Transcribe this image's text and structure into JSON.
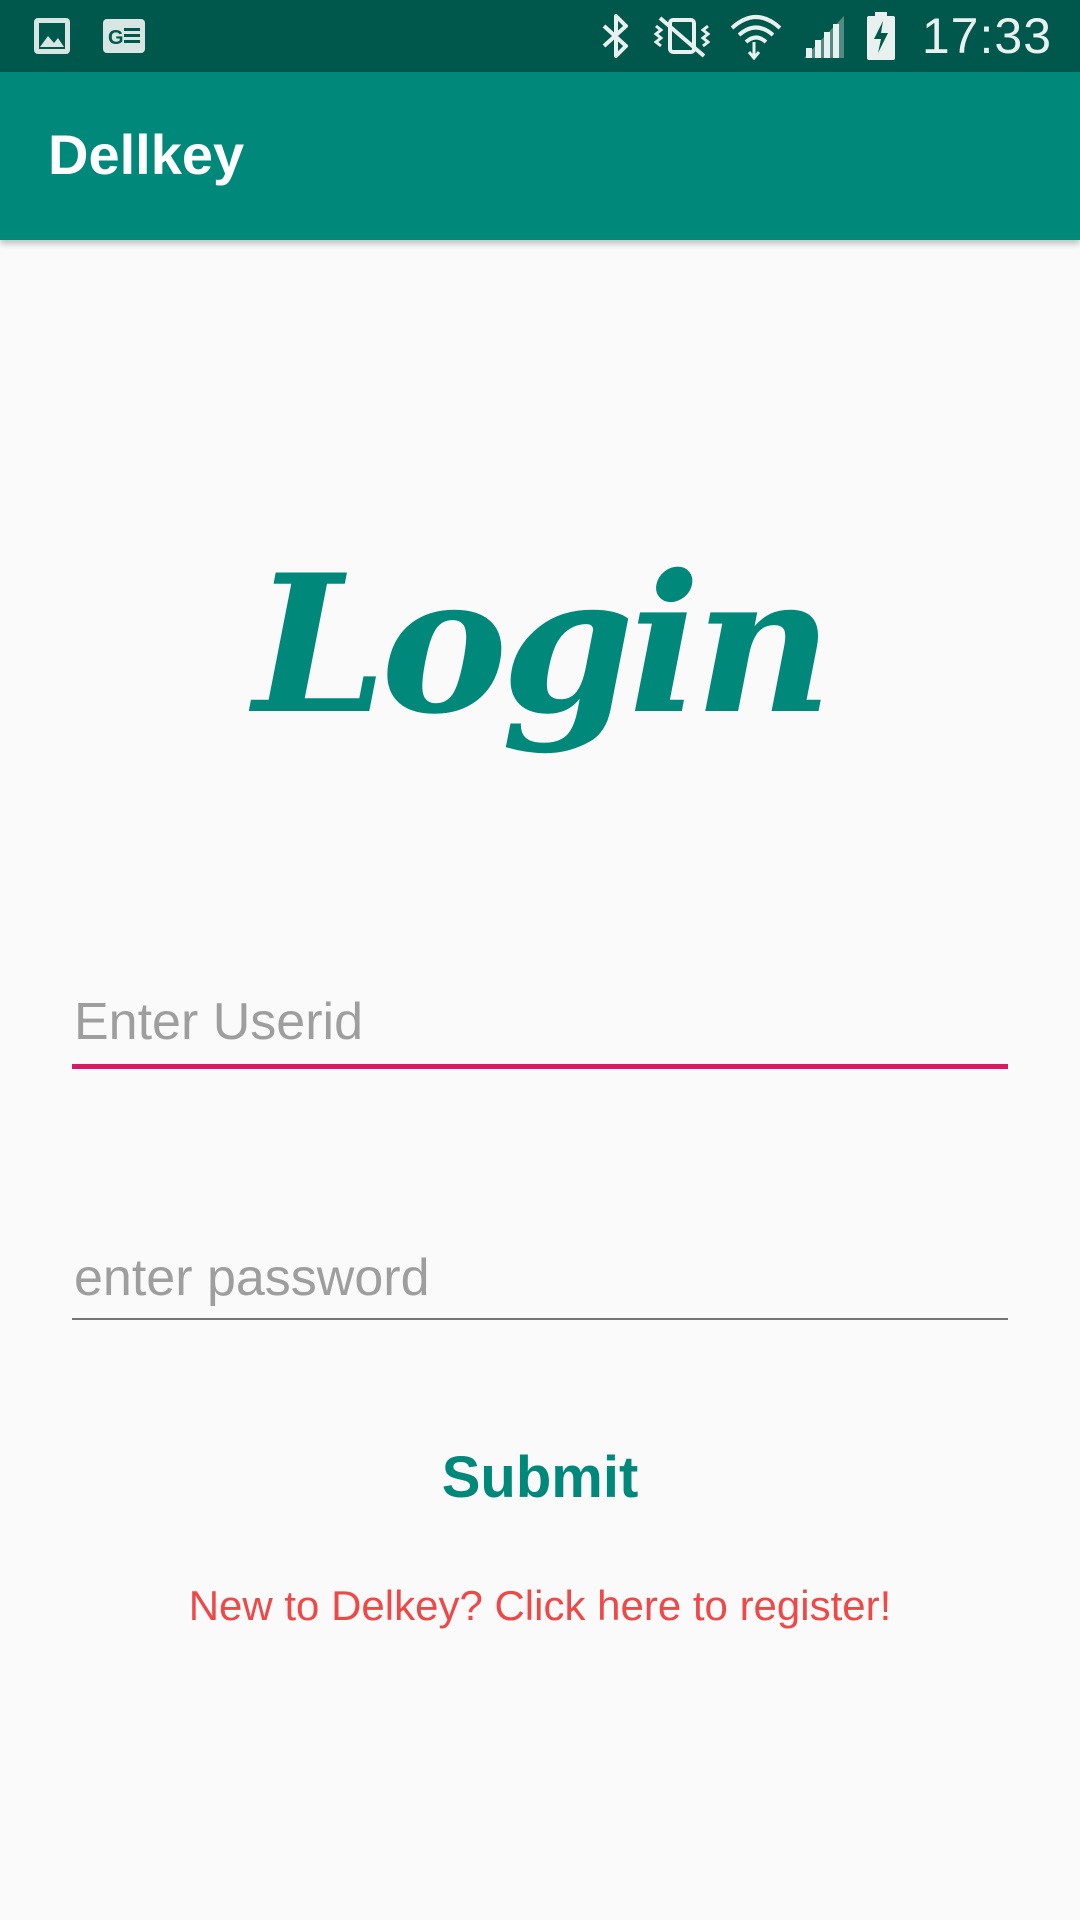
{
  "status_bar": {
    "time": "17:33",
    "icons": [
      "gallery-icon",
      "news-icon",
      "bluetooth-icon",
      "vibrate-icon",
      "wifi-icon",
      "signal-icon",
      "battery-charging-icon"
    ]
  },
  "app_bar": {
    "title": "Dellkey"
  },
  "main": {
    "heading": "Login",
    "userid_placeholder": "Enter Userid",
    "password_placeholder": "enter password",
    "submit_label": "Submit",
    "register_link": "New to Delkey? Click here to register!"
  },
  "colors": {
    "primary": "#00897b",
    "primary_dark": "#00574b",
    "accent": "#d81b60",
    "link": "#ef4848"
  }
}
